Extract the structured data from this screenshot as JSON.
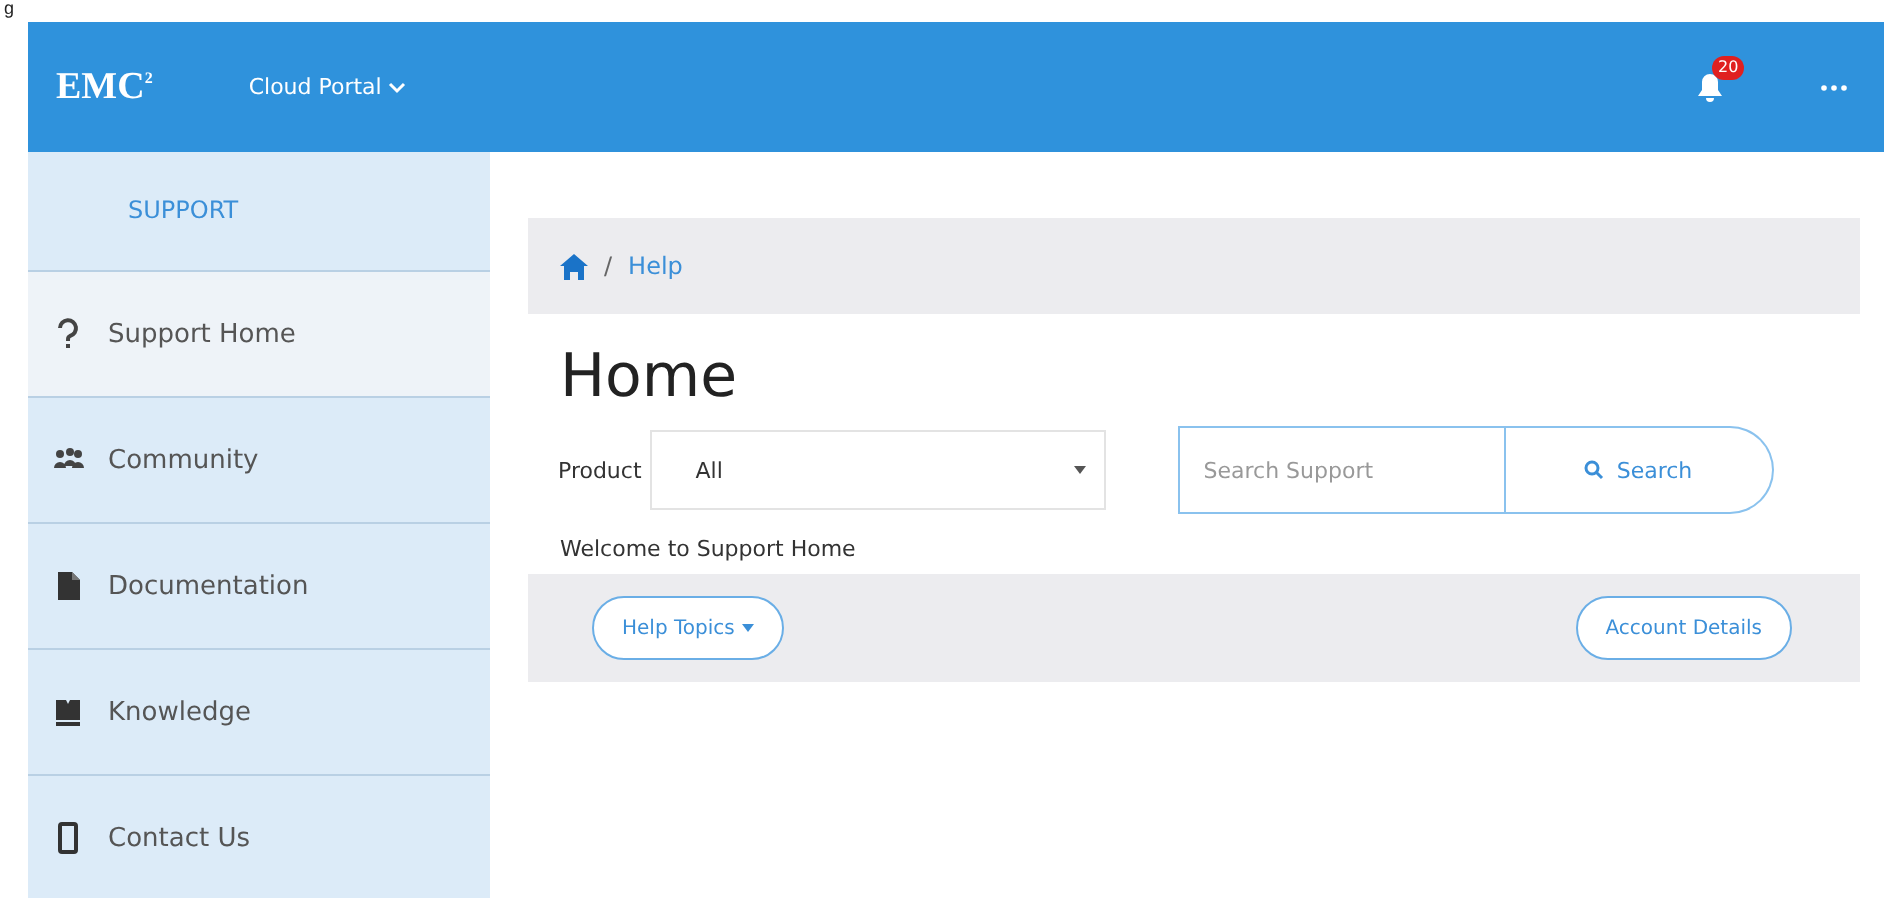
{
  "caption_fragment": "g",
  "header": {
    "logo": "EMC",
    "logo_mark": "2",
    "portal_menu": "Cloud Portal",
    "notification_count": "20"
  },
  "sidebar": {
    "title": "SUPPORT",
    "items": [
      {
        "label": "Support Home",
        "kind": "help",
        "selected": true
      },
      {
        "label": "Community",
        "kind": "community",
        "selected": false
      },
      {
        "label": "Documentation",
        "kind": "documentation",
        "selected": false
      },
      {
        "label": "Knowledge",
        "kind": "knowledge",
        "selected": false
      },
      {
        "label": "Contact Us",
        "kind": "contact",
        "selected": false
      }
    ]
  },
  "breadcrumb": {
    "separator": "/",
    "current": "Help"
  },
  "page_title": "Home",
  "product": {
    "label": "Product",
    "value": "All"
  },
  "search": {
    "placeholder": "Search Support",
    "button": "Search"
  },
  "welcome": "Welcome to Support Home",
  "actions": {
    "help_topics": "Help Topics",
    "account_details": "Account Details"
  }
}
